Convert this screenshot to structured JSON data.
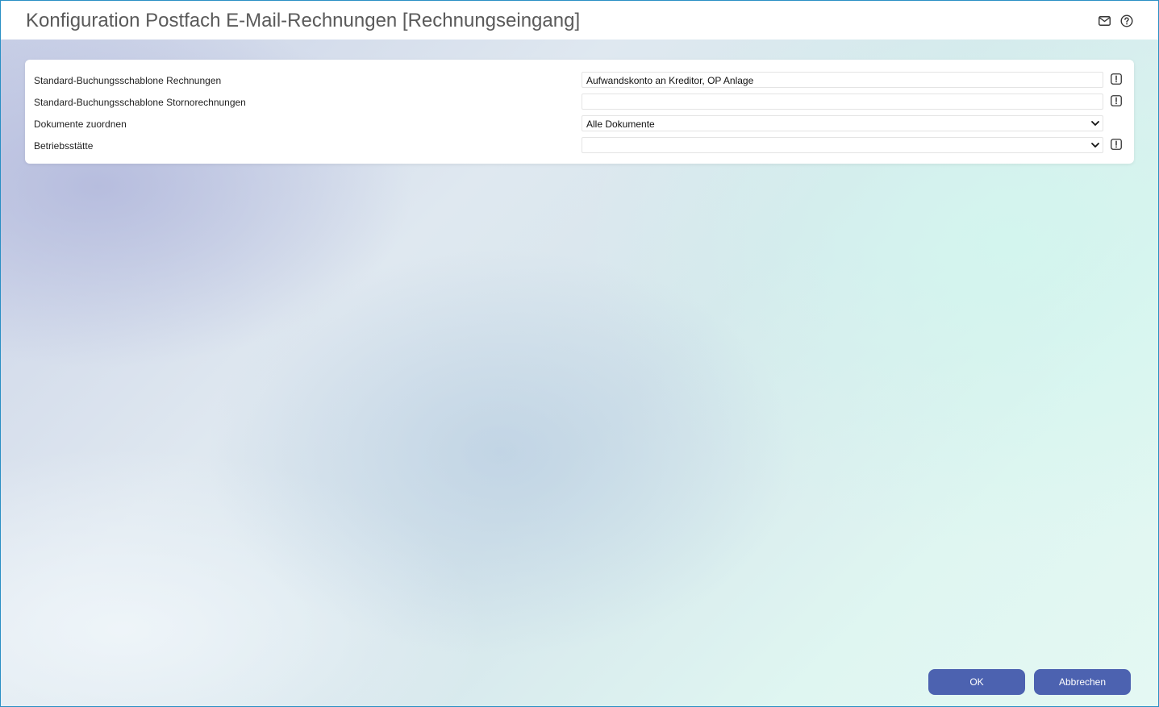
{
  "window": {
    "title": "Konfiguration Postfach E-Mail-Rechnungen [Rechnungseingang]",
    "icons": [
      "mail-icon",
      "help-icon"
    ]
  },
  "form": {
    "rows": [
      {
        "label": "Standard-Buchungsschablone Rechnungen",
        "value": "Aufwandskonto an Kreditor, OP Anlage",
        "type": "text",
        "has_info": true
      },
      {
        "label": "Standard-Buchungsschablone Stornorechnungen",
        "value": "",
        "type": "text",
        "has_info": true
      },
      {
        "label": "Dokumente zuordnen",
        "value": "Alle Dokumente",
        "type": "select",
        "has_info": false
      },
      {
        "label": "Betriebsstätte",
        "value": "",
        "type": "select",
        "has_info": true
      }
    ]
  },
  "footer": {
    "ok_label": "OK",
    "cancel_label": "Abbrechen"
  },
  "colors": {
    "accent": "#4c62b0",
    "window_border": "#2a8fc4"
  }
}
